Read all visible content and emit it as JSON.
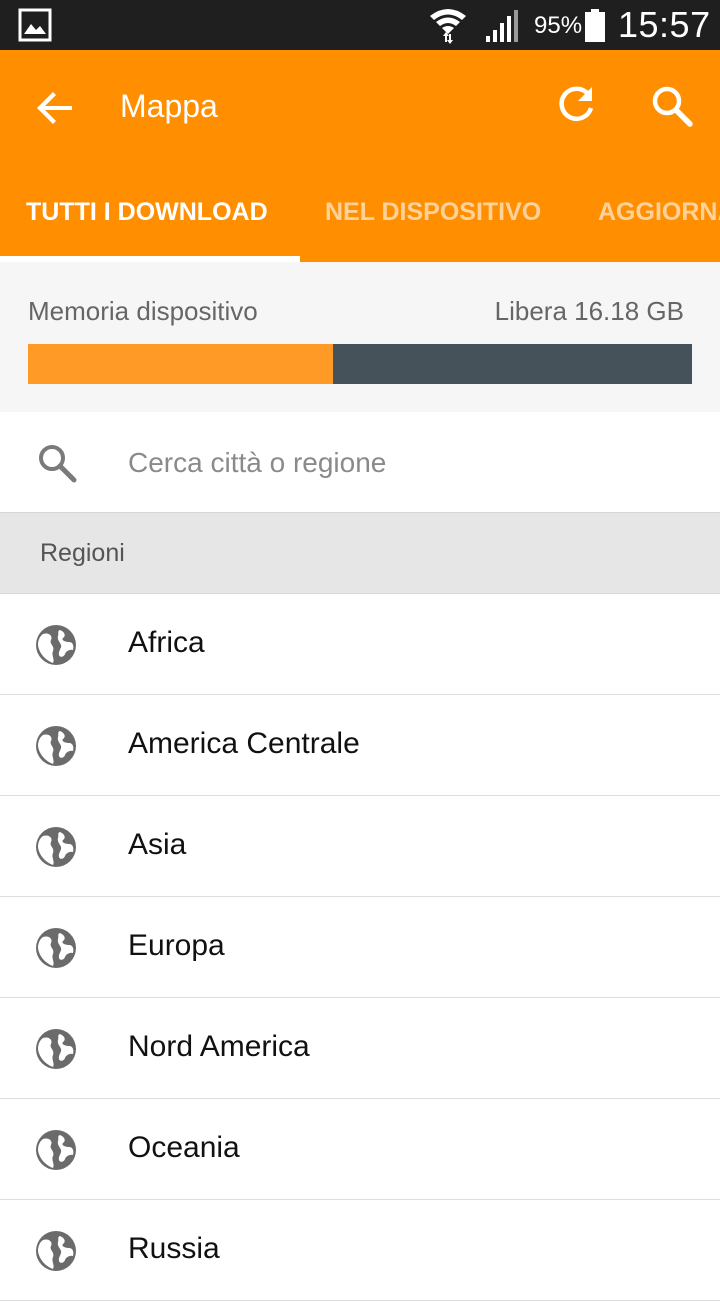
{
  "status_bar": {
    "battery_percent": "95%",
    "time": "15:57",
    "icons": [
      "gallery-icon",
      "wifi-icon",
      "signal-icon",
      "battery-icon"
    ]
  },
  "app_bar": {
    "title": "Mappa",
    "accent_color": "#ff8e00",
    "actions": [
      "back-icon",
      "refresh-icon",
      "search-icon"
    ]
  },
  "tabs": [
    {
      "label": "TUTTI I DOWNLOAD",
      "active": true
    },
    {
      "label": "NEL DISPOSITIVO",
      "active": false
    },
    {
      "label": "AGGIORNA",
      "active": false
    }
  ],
  "storage": {
    "label": "Memoria dispositivo",
    "free_text": "Libera 16.18 GB",
    "used_fraction": 0.46,
    "used_color": "#ff9a26",
    "free_color": "#455259"
  },
  "search": {
    "placeholder": "Cerca città o regione",
    "value": ""
  },
  "section": {
    "title": "Regioni"
  },
  "regions": [
    {
      "label": "Africa",
      "icon": "globe-icon"
    },
    {
      "label": "America Centrale",
      "icon": "globe-icon"
    },
    {
      "label": "Asia",
      "icon": "globe-icon"
    },
    {
      "label": "Europa",
      "icon": "globe-icon"
    },
    {
      "label": "Nord America",
      "icon": "globe-icon"
    },
    {
      "label": "Oceania",
      "icon": "globe-icon"
    },
    {
      "label": "Russia",
      "icon": "globe-icon"
    }
  ]
}
